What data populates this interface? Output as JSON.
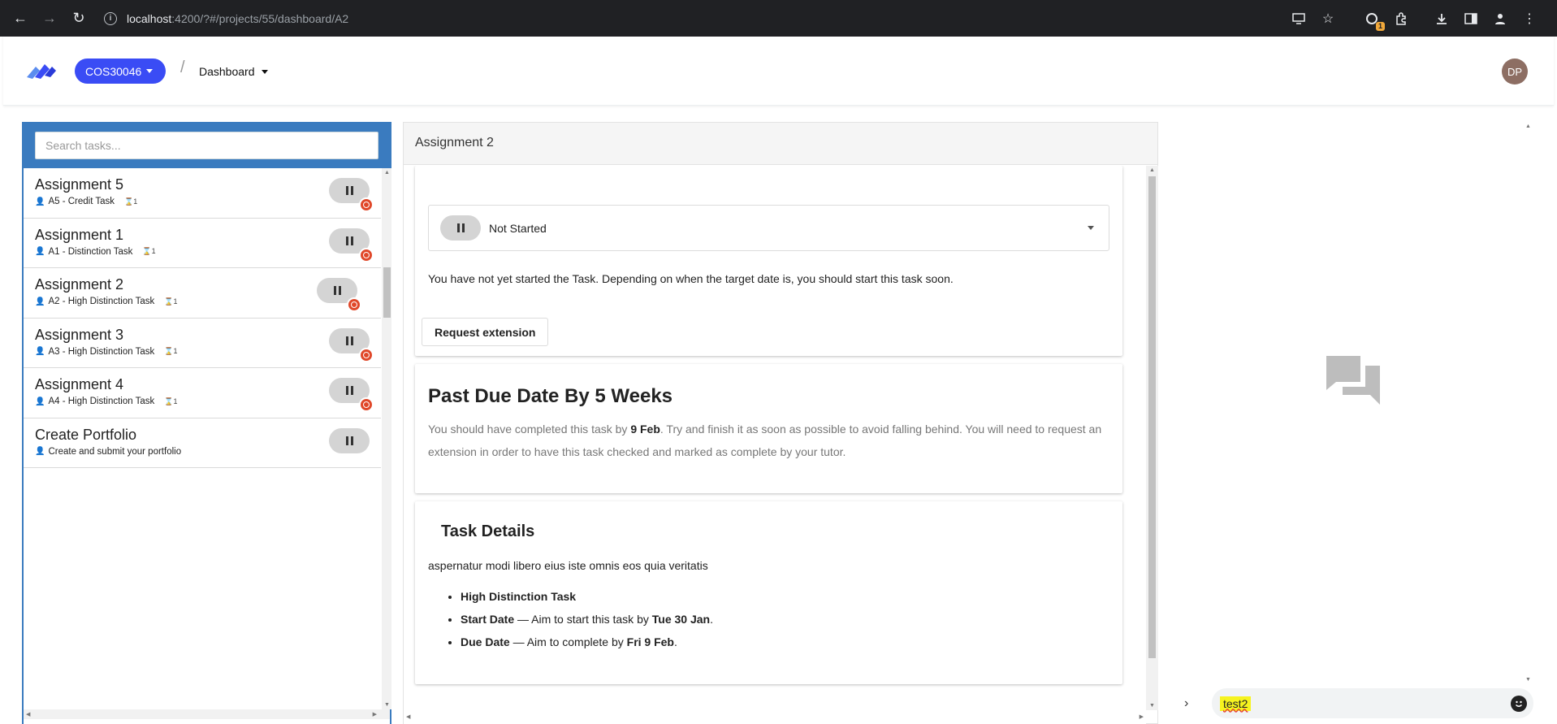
{
  "browser": {
    "url_host": "localhost",
    "url_path": ":4200/?#/projects/55/dashboard/A2",
    "extension_badge": "1"
  },
  "header": {
    "unit_code": "COS30046",
    "separator": "/",
    "view_label": "Dashboard",
    "avatar_initials": "DP"
  },
  "search": {
    "placeholder": "Search tasks..."
  },
  "tasks": [
    {
      "title": "Assignment 5",
      "code": "A5 - Credit Task",
      "count": "1",
      "overdue": true
    },
    {
      "title": "Assignment 1",
      "code": "A1 - Distinction Task",
      "count": "1",
      "overdue": true
    },
    {
      "title": "Assignment 2",
      "code": "A2 - High Distinction Task",
      "count": "1",
      "overdue": true
    },
    {
      "title": "Assignment 3",
      "code": "A3 - High Distinction Task",
      "count": "1",
      "overdue": true
    },
    {
      "title": "Assignment 4",
      "code": "A4 - High Distinction Task",
      "count": "1",
      "overdue": true
    },
    {
      "title": "Create Portfolio",
      "code": "Create and submit your portfolio",
      "count": "",
      "overdue": false
    }
  ],
  "detail": {
    "title": "Assignment 2",
    "status_label": "Not Started",
    "status_description": "You have not yet started the Task. Depending on when the target date is, you should start this task soon.",
    "request_extension_label": "Request extension",
    "due": {
      "title": "Past Due Date By 5 Weeks",
      "text_before": "You should have completed this task by ",
      "date": "9 Feb",
      "text_after": ". Try and finish it as soon as possible to avoid falling behind. You will need to request an extension in order to have this task checked and marked as complete by your tutor."
    },
    "details": {
      "title": "Task Details",
      "description": "aspernatur modi libero eius iste omnis eos quia veritatis",
      "grade": "High Distinction Task",
      "start_label": "Start Date",
      "start_text": " — Aim to start this task by ",
      "start_date": "Tue 30 Jan",
      "due_label": "Due Date",
      "due_text": " — Aim to complete by ",
      "due_date": "Fri 9 Feb",
      "period": "."
    }
  },
  "chat": {
    "input_value": "test2"
  },
  "colors": {
    "brand": "#3a4cf5",
    "panel_header": "#3a7bbf",
    "overdue": "#e0482a",
    "highlight": "#f6f31f"
  }
}
